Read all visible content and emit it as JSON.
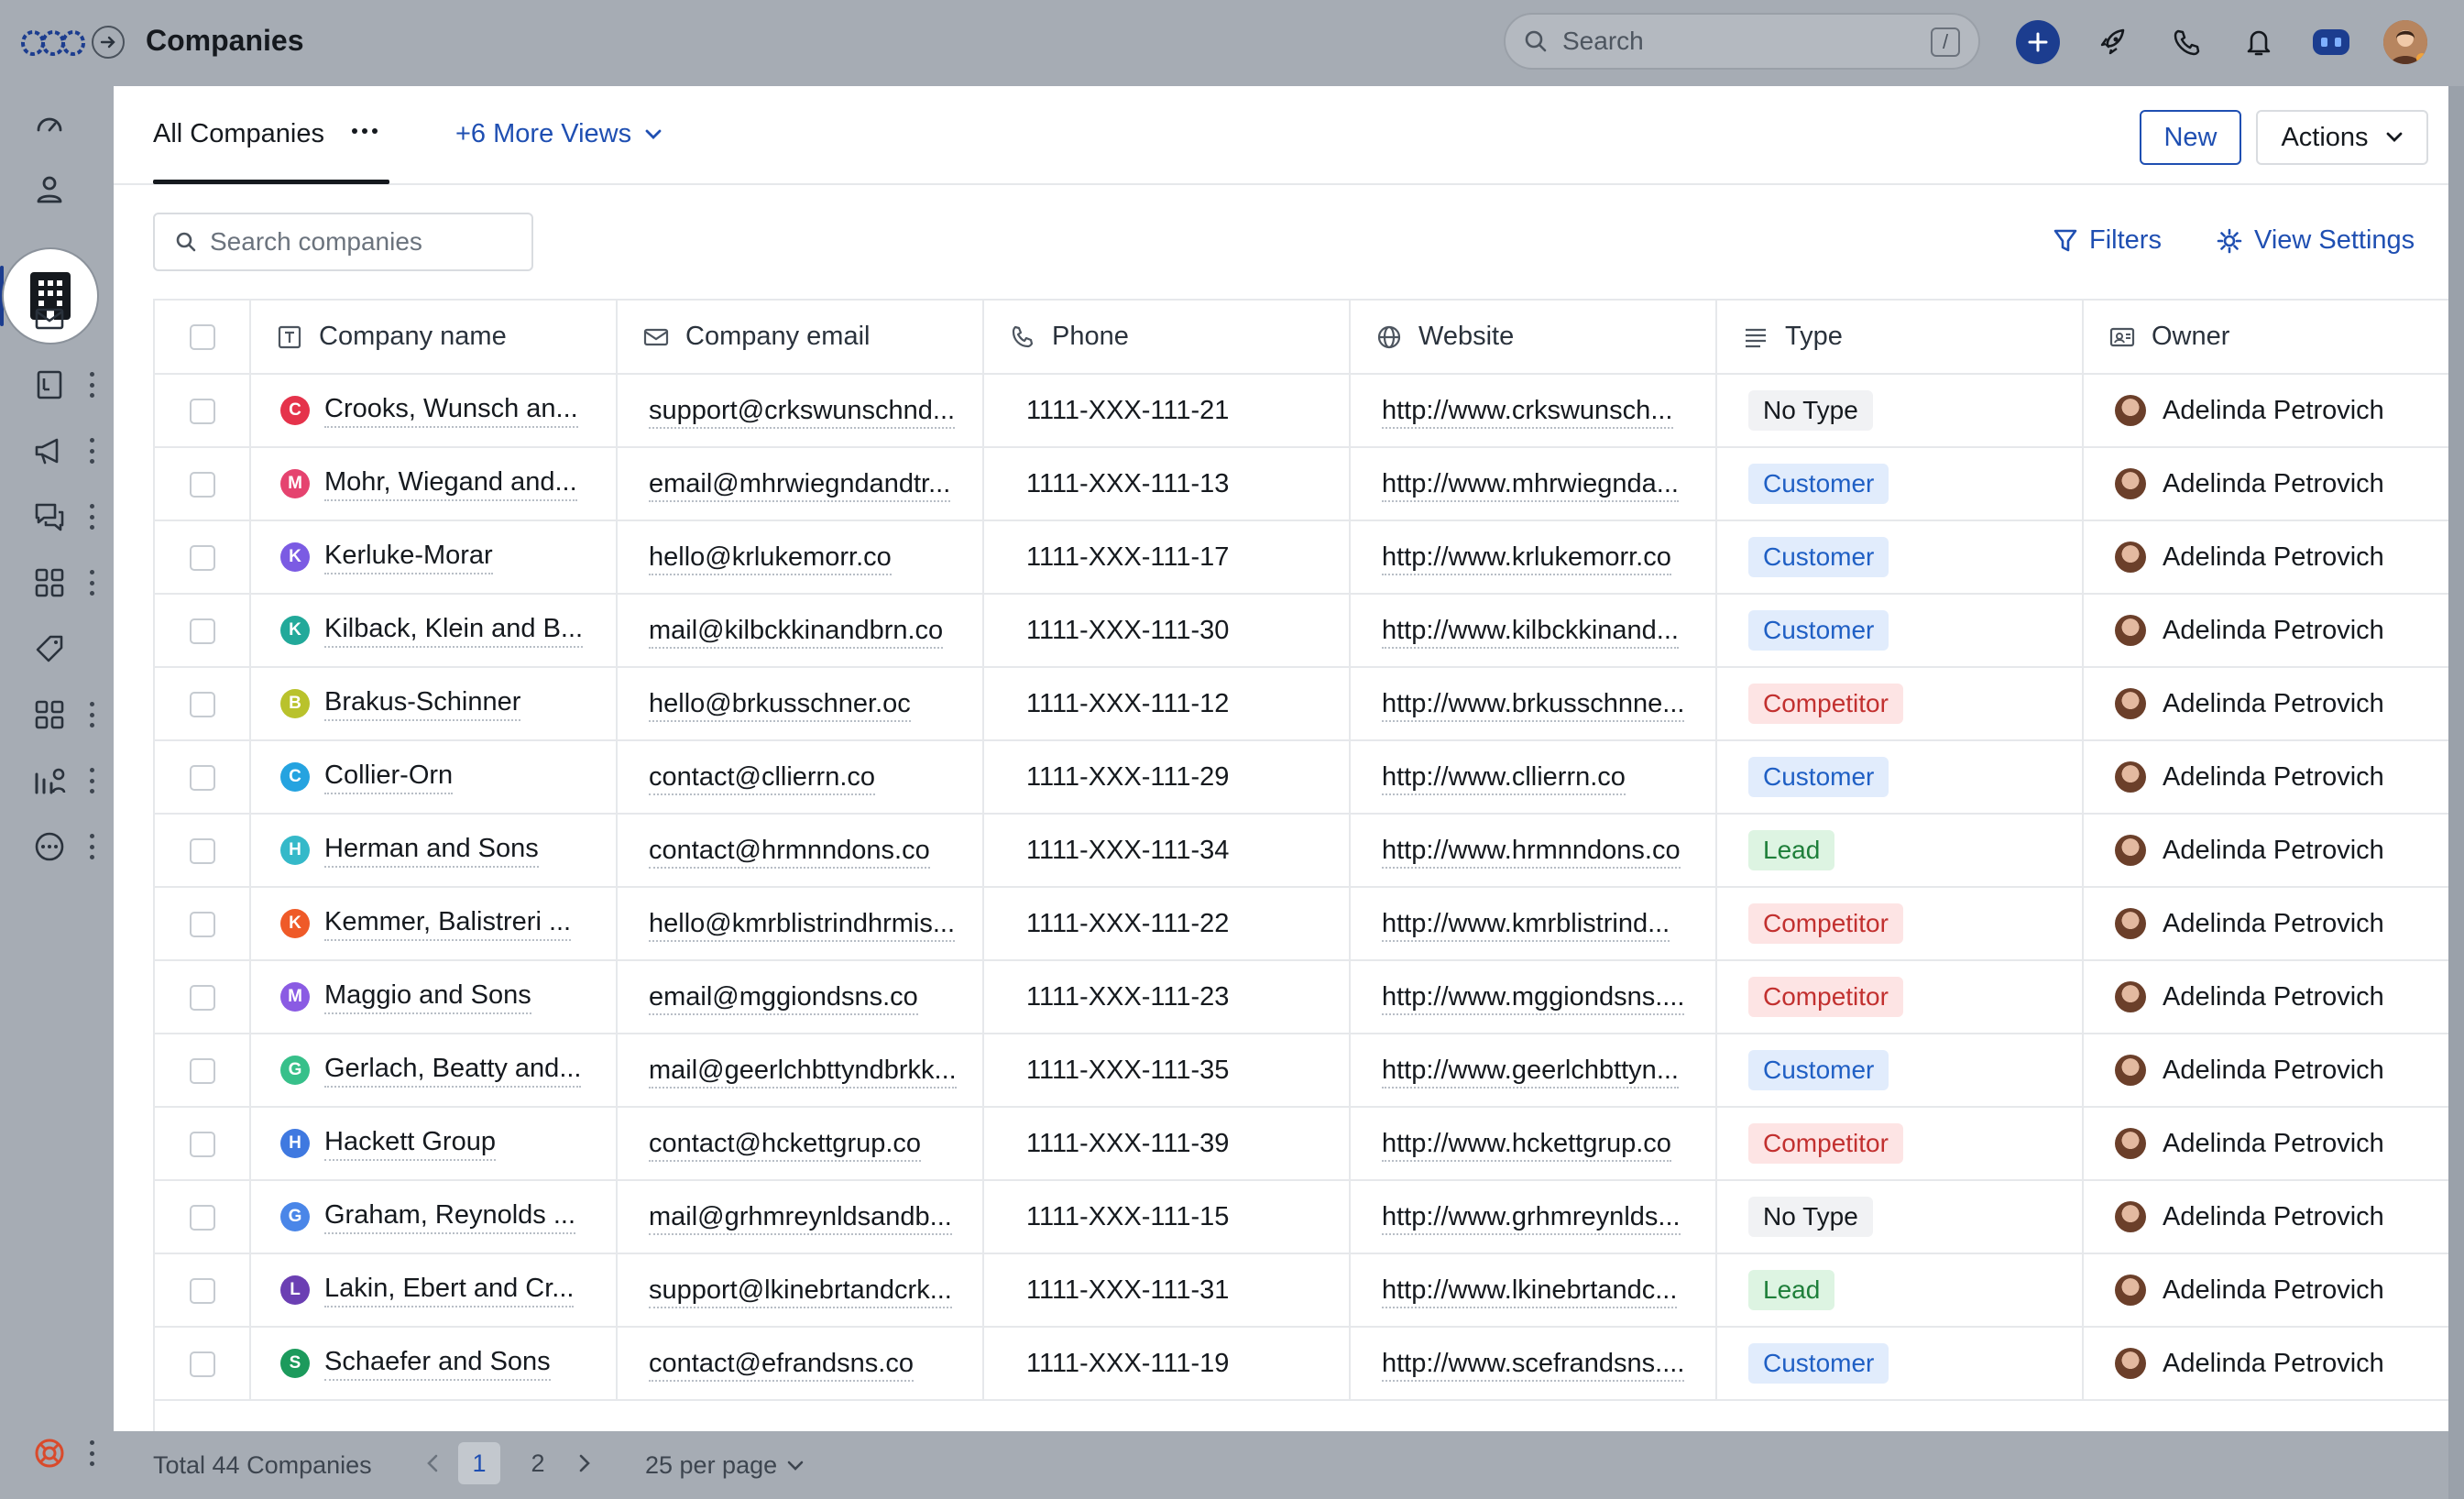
{
  "header": {
    "title": "Companies",
    "search_placeholder": "Search",
    "search_shortcut": "/"
  },
  "tabs": {
    "active_view": "All Companies",
    "more_views": "+6 More Views"
  },
  "toolbar": {
    "new_label": "New",
    "actions_label": "Actions",
    "search_placeholder": "Search companies",
    "filters_label": "Filters",
    "view_settings_label": "View Settings"
  },
  "table": {
    "columns": [
      "Company name",
      "Company email",
      "Phone",
      "Website",
      "Type",
      "Owner"
    ],
    "rows": [
      {
        "initial": "C",
        "color": "#e5334b",
        "name": "Crooks, Wunsch an...",
        "email": "support@crkswunschnd...",
        "phone": "1111-XXX-111-21",
        "website": "http://www.crkswunsch...",
        "type": "No Type",
        "owner": "Adelinda Petrovich"
      },
      {
        "initial": "M",
        "color": "#e5436f",
        "name": "Mohr, Wiegand and...",
        "email": "email@mhrwiegndandtr...",
        "phone": "1111-XXX-111-13",
        "website": "http://www.mhrwiegnda...",
        "type": "Customer",
        "owner": "Adelinda Petrovich"
      },
      {
        "initial": "K",
        "color": "#7b5be3",
        "name": "Kerluke-Morar",
        "email": "hello@krlukemorr.co",
        "phone": "1111-XXX-111-17",
        "website": "http://www.krlukemorr.co",
        "type": "Customer",
        "owner": "Adelinda Petrovich"
      },
      {
        "initial": "K",
        "color": "#22a99a",
        "name": "Kilback, Klein and B...",
        "email": "mail@kilbckkinandbrn.co",
        "phone": "1111-XXX-111-30",
        "website": "http://www.kilbckkinand...",
        "type": "Customer",
        "owner": "Adelinda Petrovich"
      },
      {
        "initial": "B",
        "color": "#b9c22c",
        "name": "Brakus-Schinner",
        "email": "hello@brkusschner.oc",
        "phone": "1111-XXX-111-12",
        "website": "http://www.brkusschnne...",
        "type": "Competitor",
        "owner": "Adelinda Petrovich"
      },
      {
        "initial": "C",
        "color": "#25a3e0",
        "name": "Collier-Orn",
        "email": "contact@cllierrn.co",
        "phone": "1111-XXX-111-29",
        "website": "http://www.cllierrn.co",
        "type": "Customer",
        "owner": "Adelinda Petrovich"
      },
      {
        "initial": "H",
        "color": "#35b9c9",
        "name": "Herman and Sons",
        "email": "contact@hrmnndons.co",
        "phone": "1111-XXX-111-34",
        "website": "http://www.hrmnndons.co",
        "type": "Lead",
        "owner": "Adelinda Petrovich"
      },
      {
        "initial": "K",
        "color": "#ef5a28",
        "name": "Kemmer, Balistreri ...",
        "email": "hello@kmrblistrindhrmis...",
        "phone": "1111-XXX-111-22",
        "website": "http://www.kmrblistrind...",
        "type": "Competitor",
        "owner": "Adelinda Petrovich"
      },
      {
        "initial": "M",
        "color": "#8a5be3",
        "name": "Maggio and Sons",
        "email": "email@mggiondsns.co",
        "phone": "1111-XXX-111-23",
        "website": "http://www.mggiondsns....",
        "type": "Competitor",
        "owner": "Adelinda Petrovich"
      },
      {
        "initial": "G",
        "color": "#37c08a",
        "name": "Gerlach, Beatty and...",
        "email": "mail@geerlchbttyndbrkk...",
        "phone": "1111-XXX-111-35",
        "website": "http://www.geerlchbttyn...",
        "type": "Customer",
        "owner": "Adelinda Petrovich"
      },
      {
        "initial": "H",
        "color": "#3f79e0",
        "name": "Hackett Group",
        "email": "contact@hckettgrup.co",
        "phone": "1111-XXX-111-39",
        "website": "http://www.hckettgrup.co",
        "type": "Competitor",
        "owner": "Adelinda Petrovich"
      },
      {
        "initial": "G",
        "color": "#4a86e8",
        "name": "Graham, Reynolds ...",
        "email": "mail@grhmreynldsandb...",
        "phone": "1111-XXX-111-15",
        "website": "http://www.grhmreynlds...",
        "type": "No Type",
        "owner": "Adelinda Petrovich"
      },
      {
        "initial": "L",
        "color": "#6b3fb3",
        "name": "Lakin, Ebert and Cr...",
        "email": "support@lkinebrtandcrk...",
        "phone": "1111-XXX-111-31",
        "website": "http://www.lkinebrtandc...",
        "type": "Lead",
        "owner": "Adelinda Petrovich"
      },
      {
        "initial": "S",
        "color": "#1c9a5c",
        "name": "Schaefer and Sons",
        "email": "contact@efrandsns.co",
        "phone": "1111-XXX-111-19",
        "website": "http://www.scefrandsns....",
        "type": "Customer",
        "owner": "Adelinda Petrovich"
      }
    ]
  },
  "footer": {
    "total": "Total 44 Companies",
    "pages": [
      "1",
      "2"
    ],
    "current_page": "1",
    "per_page": "25 per page"
  },
  "icons": {
    "rail": [
      "dashboard-icon",
      "contacts-icon",
      "companies-icon",
      "mail-icon",
      "notes-icon",
      "campaigns-icon",
      "conversations-icon",
      "apps-icon",
      "tag-icon",
      "apps-alt-icon",
      "reports-icon",
      "more-icon",
      "help-icon"
    ]
  },
  "colors": {
    "accent": "#1f4fb2",
    "plus_button": "#1c3d8f"
  }
}
